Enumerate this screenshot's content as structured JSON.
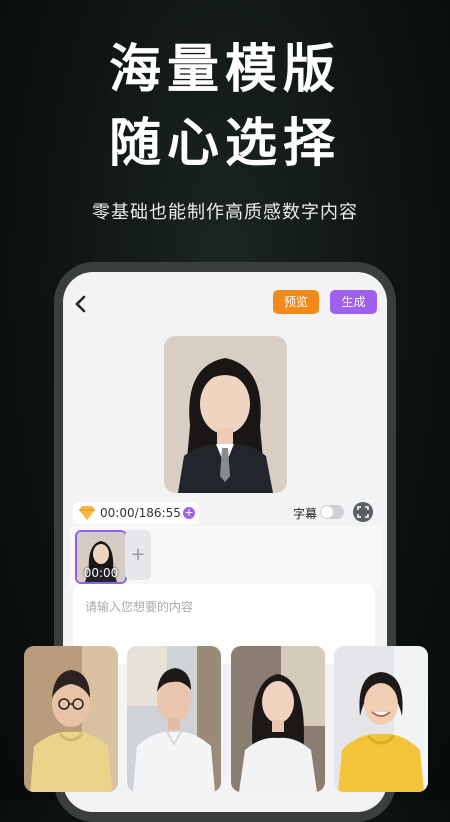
{
  "headline": {
    "line1": "海量模版",
    "line2": "随心选择"
  },
  "subheadline": "零基础也能制作高质感数字内容",
  "app": {
    "header": {
      "preview_label": "预览",
      "generate_label": "生成"
    },
    "timebar": {
      "time": "00:00/186:55"
    },
    "subtitle_label": "字幕",
    "clip": {
      "duration": "00:00"
    },
    "text_input": {
      "placeholder": "请输入您想要的内容"
    }
  },
  "colors": {
    "accent_orange": "#f08a1a",
    "accent_purple": "#a060ee"
  }
}
